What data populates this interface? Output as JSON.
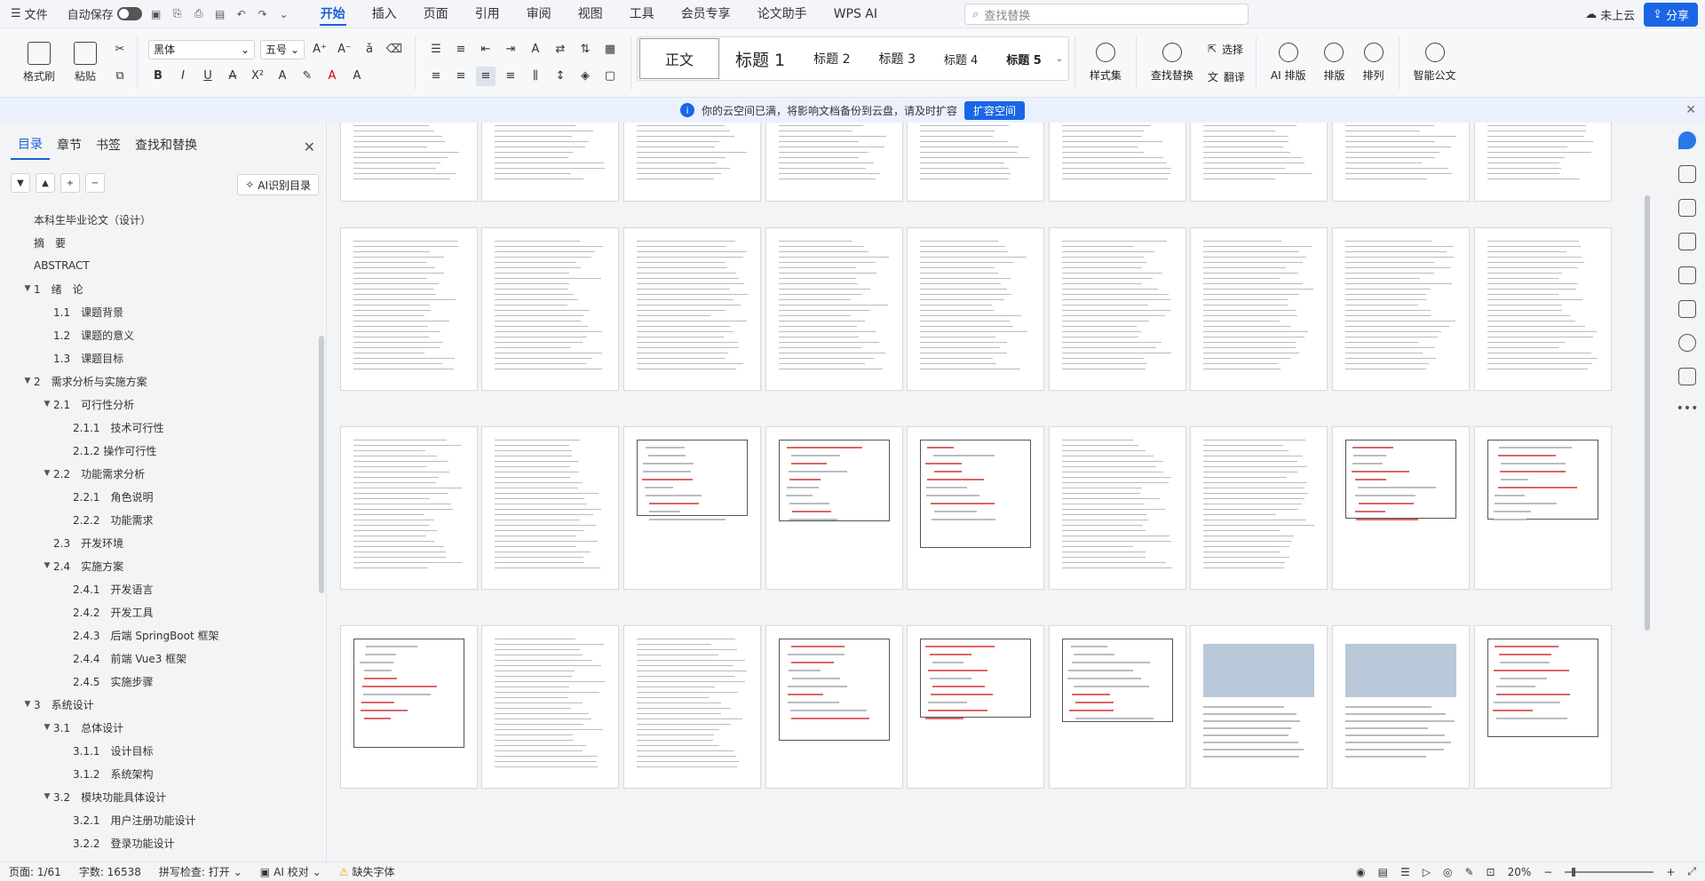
{
  "topbar": {
    "file_label": "文件",
    "autosave_label": "自动保存",
    "menu": [
      "开始",
      "插入",
      "页面",
      "引用",
      "审阅",
      "视图",
      "工具",
      "会员专享",
      "论文助手",
      "WPS AI"
    ],
    "active_menu": "开始",
    "search_placeholder": "查找替换",
    "cloud_label": "未上云",
    "share_label": "分享"
  },
  "ribbon": {
    "format_painter": "格式刷",
    "paste": "粘贴",
    "font_name": "黑体",
    "font_size": "五号",
    "styles": [
      "正文",
      "标题 1",
      "标题 2",
      "标题 3",
      "标题 4",
      "标题 5"
    ],
    "style_set": "样式集",
    "find_replace": "查找替换",
    "select": "选择",
    "translate": "翻译",
    "ai_layout": "AI 排版",
    "layout": "排版",
    "arrange": "排列",
    "smart_doc": "智能公文"
  },
  "notice": {
    "text": "你的云空间已满，将影响文档备份到云盘，请及时扩容",
    "button": "扩容空间"
  },
  "sidebar": {
    "tabs": [
      "目录",
      "章节",
      "书签",
      "查找和替换"
    ],
    "active_tab": "目录",
    "ai_button": "AI识别目录",
    "toc": [
      {
        "text": "本科生毕业论文（设计）",
        "level": 0,
        "arrow": ""
      },
      {
        "text": "摘　要",
        "level": 0,
        "arrow": ""
      },
      {
        "text": "ABSTRACT",
        "level": 0,
        "arrow": ""
      },
      {
        "text": "1　绪　论",
        "level": 0,
        "arrow": "▼"
      },
      {
        "text": "1.1　课题背景",
        "level": 1,
        "arrow": ""
      },
      {
        "text": "1.2　课题的意义",
        "level": 1,
        "arrow": ""
      },
      {
        "text": "1.3　课题目标",
        "level": 1,
        "arrow": ""
      },
      {
        "text": "2　需求分析与实施方案",
        "level": 0,
        "arrow": "▼"
      },
      {
        "text": "2.1　可行性分析",
        "level": 1,
        "arrow": "▼"
      },
      {
        "text": "2.1.1　技术可行性",
        "level": 2,
        "arrow": ""
      },
      {
        "text": "2.1.2 操作可行性",
        "level": 2,
        "arrow": ""
      },
      {
        "text": "2.2　功能需求分析",
        "level": 1,
        "arrow": "▼"
      },
      {
        "text": "2.2.1　角色说明",
        "level": 2,
        "arrow": ""
      },
      {
        "text": "2.2.2　功能需求",
        "level": 2,
        "arrow": ""
      },
      {
        "text": "2.3　开发环境",
        "level": 1,
        "arrow": ""
      },
      {
        "text": "2.4　实施方案",
        "level": 1,
        "arrow": "▼"
      },
      {
        "text": "2.4.1　开发语言",
        "level": 2,
        "arrow": ""
      },
      {
        "text": "2.4.2　开发工具",
        "level": 2,
        "arrow": ""
      },
      {
        "text": "2.4.3　后端 SpringBoot 框架",
        "level": 2,
        "arrow": ""
      },
      {
        "text": "2.4.4　前端 Vue3 框架",
        "level": 2,
        "arrow": ""
      },
      {
        "text": "2.4.5　实施步骤",
        "level": 2,
        "arrow": ""
      },
      {
        "text": "3　系统设计",
        "level": 0,
        "arrow": "▼"
      },
      {
        "text": "3.1　总体设计",
        "level": 1,
        "arrow": "▼"
      },
      {
        "text": "3.1.1　设计目标",
        "level": 2,
        "arrow": ""
      },
      {
        "text": "3.1.2　系统架构",
        "level": 2,
        "arrow": ""
      },
      {
        "text": "3.2　模块功能具体设计",
        "level": 1,
        "arrow": "▼"
      },
      {
        "text": "3.2.1　用户注册功能设计",
        "level": 2,
        "arrow": ""
      },
      {
        "text": "3.2.2　登录功能设计",
        "level": 2,
        "arrow": ""
      }
    ]
  },
  "status": {
    "page": "页面: 1/61",
    "words": "字数: 16538",
    "spell": "拼写检查: 打开",
    "ai_check": "AI 校对",
    "missing_font": "缺失字体",
    "zoom": "20%"
  },
  "colors": {
    "accent": "#1a5fd6",
    "share": "#1a66e6"
  }
}
